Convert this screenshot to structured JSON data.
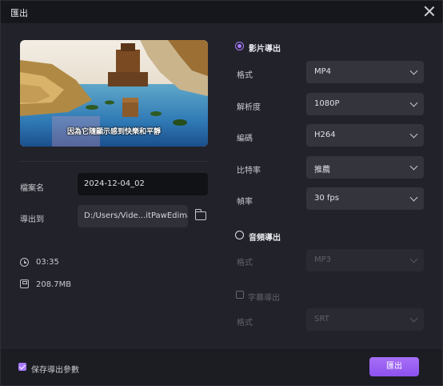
{
  "window": {
    "title": "匯出"
  },
  "preview": {
    "subtitle": "因為它隨顯示感到快樂和平靜"
  },
  "file": {
    "name_label": "檔案名",
    "name_value": "2024-12-04_02",
    "path_label": "導出到",
    "path_value": "D:/Users/Vide...itPawEdimakor",
    "folder_icon": "folder-icon"
  },
  "info": {
    "duration": "03:35",
    "size": "208.7MB"
  },
  "video_export": {
    "label": "影片導出",
    "selected": true,
    "rows": [
      {
        "label": "格式",
        "value": "MP4"
      },
      {
        "label": "解析度",
        "value": "1080P"
      },
      {
        "label": "編碼",
        "value": "H264"
      },
      {
        "label": "比特率",
        "value": "推薦"
      },
      {
        "label": "幀率",
        "value": "30  fps"
      }
    ]
  },
  "audio_export": {
    "label": "音頻導出",
    "selected": false,
    "format_label": "格式",
    "format_value": "MP3"
  },
  "subtitle_export": {
    "label": "字幕導出",
    "checked": false,
    "format_label": "格式",
    "format_value": "SRT"
  },
  "footer": {
    "save_params_label": "保存導出參數",
    "save_params_checked": true,
    "export_button": "匯出"
  },
  "colors": {
    "accent": "#a77bff",
    "background": "#22232a"
  }
}
